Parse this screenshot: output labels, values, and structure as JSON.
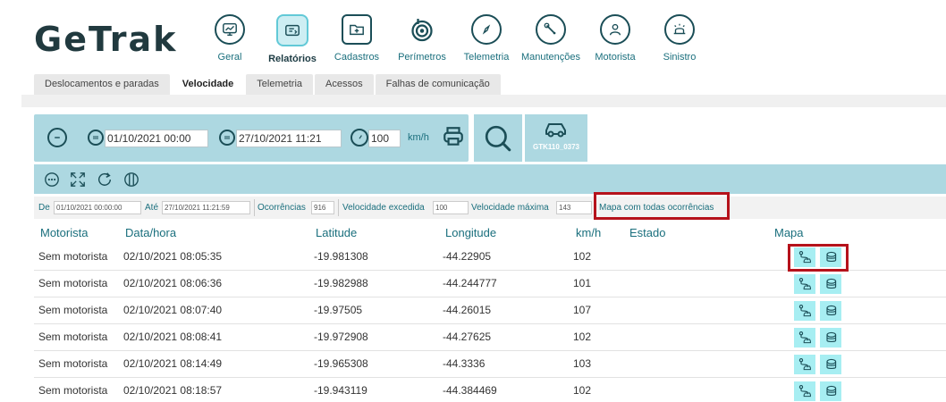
{
  "app": {
    "logo": "GeTrak"
  },
  "nav": [
    {
      "label": "Geral",
      "icon": "monitor-icon",
      "active": false
    },
    {
      "label": "Relatórios",
      "icon": "report-icon",
      "active": true
    },
    {
      "label": "Cadastros",
      "icon": "folder-plus-icon",
      "active": false
    },
    {
      "label": "Perímetros",
      "icon": "target-icon",
      "active": false
    },
    {
      "label": "Telemetria",
      "icon": "compass-icon",
      "active": false
    },
    {
      "label": "Manutenções",
      "icon": "wrench-icon",
      "active": false
    },
    {
      "label": "Motorista",
      "icon": "driver-icon",
      "active": false
    },
    {
      "label": "Sinistro",
      "icon": "siren-icon",
      "active": false
    }
  ],
  "subtabs": [
    {
      "label": "Deslocamentos e paradas",
      "active": false
    },
    {
      "label": "Velocidade",
      "active": true
    },
    {
      "label": "Telemetria",
      "active": false
    },
    {
      "label": "Acessos",
      "active": false
    },
    {
      "label": "Falhas de comunicação",
      "active": false
    }
  ],
  "filter": {
    "date_from": "01/10/2021 00:00",
    "date_to": "27/10/2021 11:21",
    "speed_limit": "100",
    "speed_unit": "km/h",
    "vehicle": "GTK110_0373"
  },
  "info": {
    "de_label": "De",
    "de_value": "01/10/2021 00:00:00",
    "ate_label": "Até",
    "ate_value": "27/10/2021 11:21:59",
    "ocorrencias_label": "Ocorrências",
    "ocorrencias_value": "916",
    "vel_excedida_label": "Velocidade excedida",
    "vel_excedida_value": "100",
    "vel_maxima_label": "Velocidade máxima",
    "vel_maxima_value": "143",
    "map_all_link": "Mapa com todas ocorrências"
  },
  "table": {
    "headers": [
      "Motorista",
      "Data/hora",
      "Latitude",
      "Longitude",
      "km/h",
      "Estado",
      "Mapa"
    ],
    "rows": [
      {
        "motorista": "Sem motorista",
        "datahora": "02/10/2021 08:05:35",
        "lat": "-19.981308",
        "lng": "-44.22905",
        "kmh": "102",
        "estado": ""
      },
      {
        "motorista": "Sem motorista",
        "datahora": "02/10/2021 08:06:36",
        "lat": "-19.982988",
        "lng": "-44.244777",
        "kmh": "101",
        "estado": ""
      },
      {
        "motorista": "Sem motorista",
        "datahora": "02/10/2021 08:07:40",
        "lat": "-19.97505",
        "lng": "-44.26015",
        "kmh": "107",
        "estado": ""
      },
      {
        "motorista": "Sem motorista",
        "datahora": "02/10/2021 08:08:41",
        "lat": "-19.972908",
        "lng": "-44.27625",
        "kmh": "102",
        "estado": ""
      },
      {
        "motorista": "Sem motorista",
        "datahora": "02/10/2021 08:14:49",
        "lat": "-19.965308",
        "lng": "-44.3336",
        "kmh": "103",
        "estado": ""
      },
      {
        "motorista": "Sem motorista",
        "datahora": "02/10/2021 08:18:57",
        "lat": "-19.943119",
        "lng": "-44.384469",
        "kmh": "102",
        "estado": ""
      }
    ]
  },
  "colors": {
    "accent": "#1a6f7d",
    "panel": "#add8e1",
    "highlight": "#b5121b",
    "map_button": "#a7eef2"
  }
}
